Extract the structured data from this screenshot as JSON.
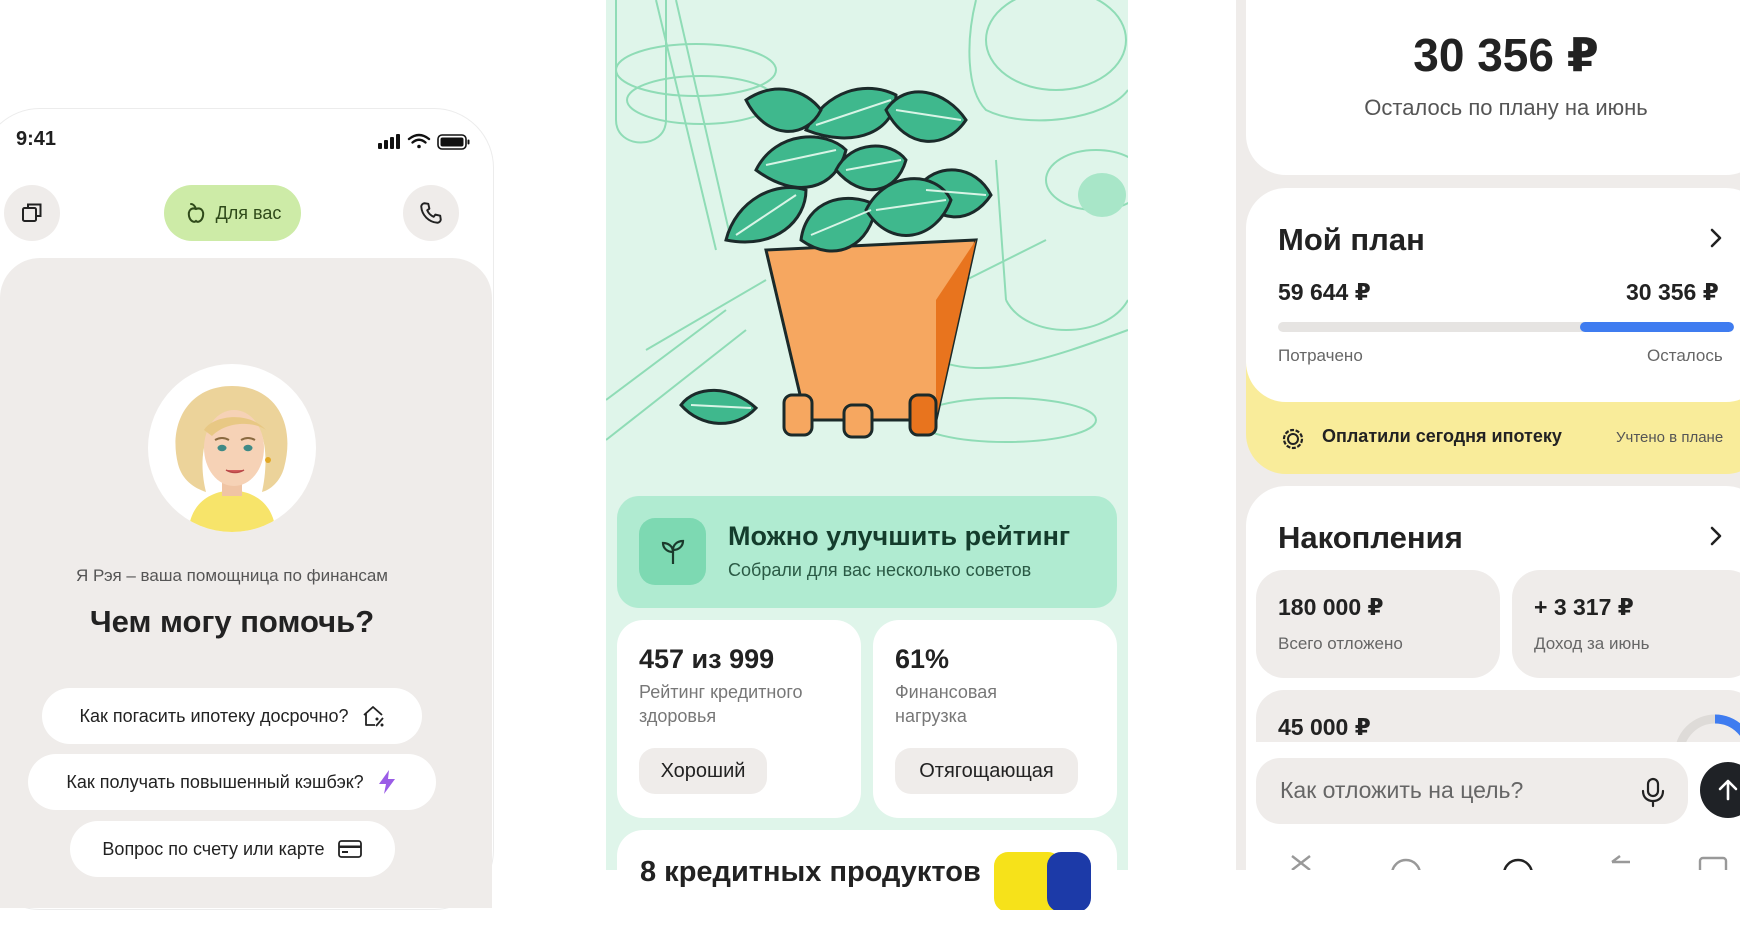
{
  "assistant": {
    "status_time": "9:41",
    "for_you_label": "Для вас",
    "intro": "Я Рэя – ваша помощница по финансам",
    "question": "Чем могу помочь?",
    "suggestions": [
      {
        "label": "Как погасить ипотеку досрочно?",
        "icon": "house-percent-icon"
      },
      {
        "label": "Как получать повышенный кэшбэк?",
        "icon": "lightning-icon"
      },
      {
        "label": "Вопрос по счету или карте",
        "icon": "card-icon"
      }
    ],
    "colors": {
      "accent": "#cdeba7",
      "background": "#efecea"
    }
  },
  "rating": {
    "improve_title": "Можно улучшить рейтинг",
    "improve_subtitle": "Собрали для вас несколько советов",
    "cards": [
      {
        "value": "457 из 999",
        "label": "Рейтинг кредитного здоровья",
        "status": "Хороший"
      },
      {
        "value": "61%",
        "label": "Финансовая нагрузка",
        "status": "Отягощающая"
      }
    ],
    "next_title": "8 кредитных продуктов",
    "colors": {
      "background": "#dff5ea",
      "accent": "#b0ebd1",
      "icon_bg": "#7dd9b2"
    }
  },
  "plan": {
    "remaining_amount": "30 356 ₽",
    "remaining_caption": "Осталось по плану на июнь",
    "my_plan_title": "Мой план",
    "spent_amount": "59 644 ₽",
    "left_amount": "30 356 ₽",
    "spent_label": "Потрачено",
    "left_label": "Осталось",
    "progress_left_fraction": 0.337,
    "notice_text": "Оплатили сегодня ипотеку",
    "notice_tag": "Учтено в плане",
    "savings_title": "Накопления",
    "saved_total": "180 000 ₽",
    "saved_total_label": "Всего отложено",
    "income": "+ 3 317 ₽",
    "income_label": "Доход за июнь",
    "goal_amount": "45 000 ₽",
    "input_placeholder": "Как отложить на цель?",
    "colors": {
      "progress": "#3f7cf0",
      "notice": "#f9ec9a"
    }
  }
}
